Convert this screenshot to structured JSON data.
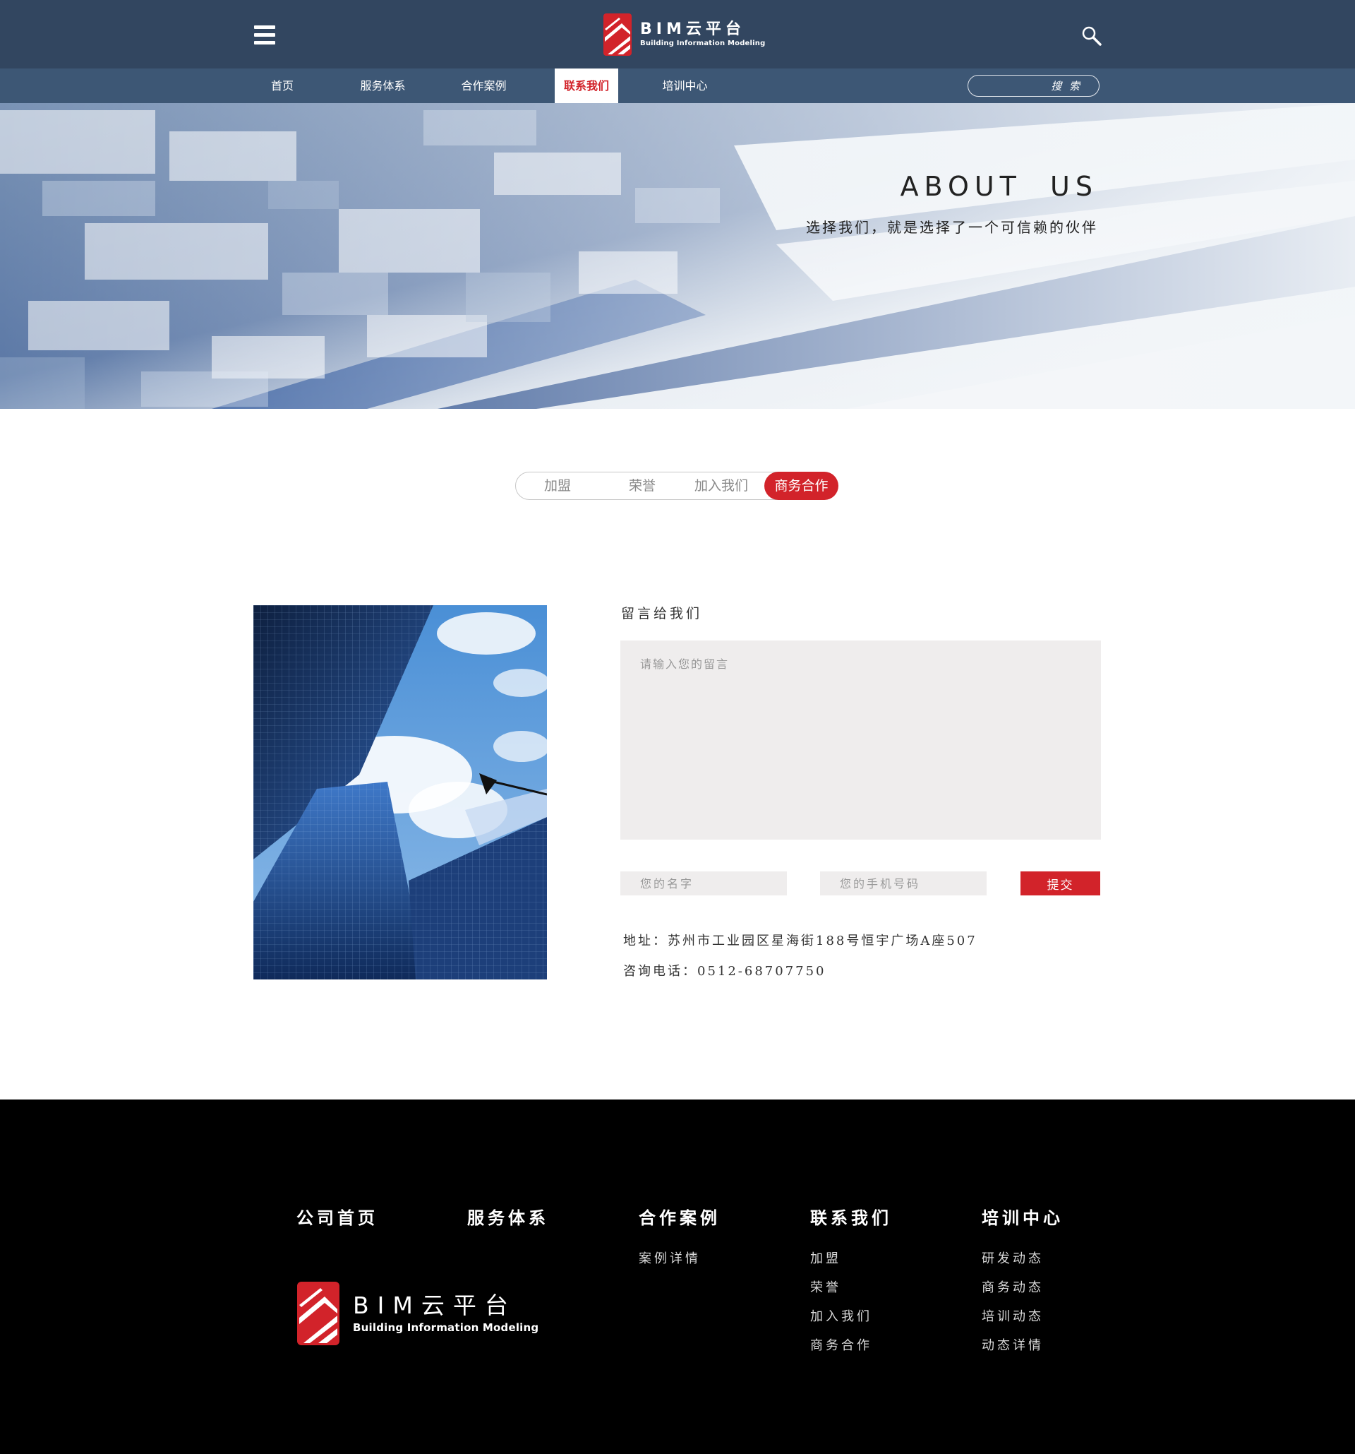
{
  "header": {
    "logo": {
      "title": "BIM云平台",
      "subtitle": "Building Information Modeling"
    }
  },
  "nav": {
    "items": [
      "首页",
      "服务体系",
      "合作案例",
      "联系我们",
      "培训中心"
    ],
    "active": "联系我们",
    "search_placeholder": "搜 索"
  },
  "banner": {
    "title": "ABOUT  US",
    "subtitle": "选择我们，就是选择了一个可信赖的伙伴"
  },
  "tabs": {
    "items": [
      "加盟",
      "荣誉",
      "加入我们",
      "商务合作"
    ],
    "active": "商务合作"
  },
  "contact": {
    "title": "留言给我们",
    "message_placeholder": "请输入您的留言",
    "name_placeholder": "您的名字",
    "phone_placeholder": "您的手机号码",
    "submit_label": "提交",
    "address": "地址：苏州市工业园区星海街188号恒宇广场A座507",
    "phone": "咨询电话：0512-68707750"
  },
  "footer": {
    "columns": [
      {
        "title": "公司首页",
        "links": []
      },
      {
        "title": "服务体系",
        "links": []
      },
      {
        "title": "合作案例",
        "links": [
          "案例详情"
        ]
      },
      {
        "title": "联系我们",
        "links": [
          "加盟",
          "荣誉",
          "加入我们",
          "商务合作"
        ]
      },
      {
        "title": "培训中心",
        "links": [
          "研发动态",
          "商务动态",
          "培训动态",
          "动态详情"
        ]
      }
    ],
    "logo": {
      "title": "BIM云平台",
      "subtitle": "Building Information Modeling"
    }
  },
  "icons": [
    "menu-icon",
    "search-icon",
    "logo-icon"
  ],
  "colors": {
    "header_bg": "#324660",
    "nav_bg": "#3d5775",
    "accent": "#d2232a",
    "footer_bg": "#000000"
  }
}
